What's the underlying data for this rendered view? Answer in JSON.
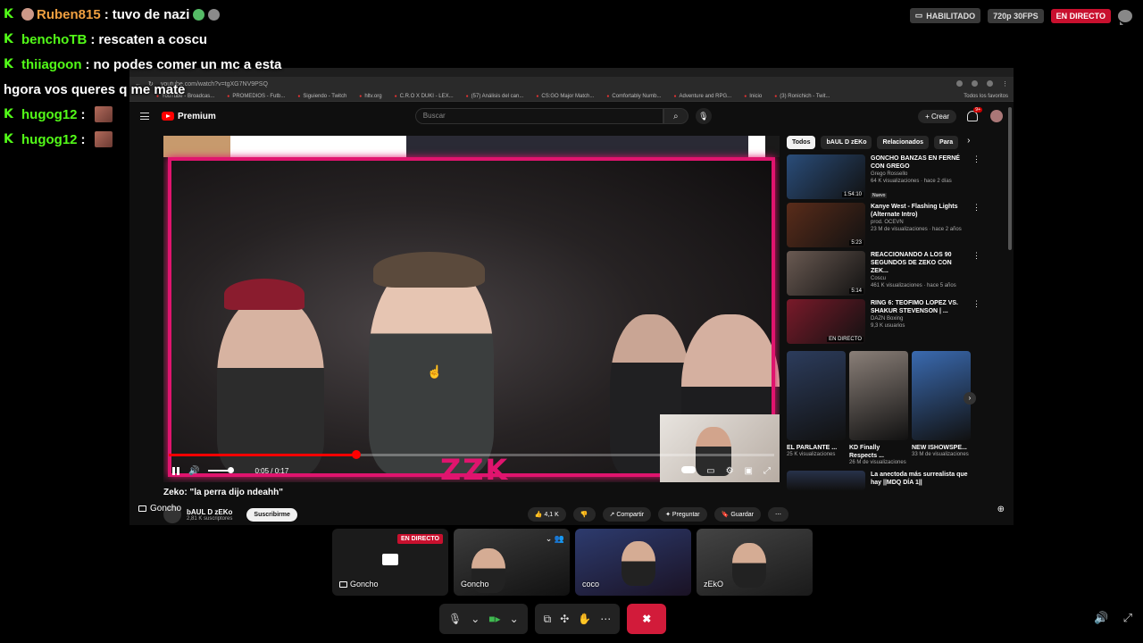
{
  "status": {
    "habilitado": "HABILITADO",
    "quality": "720p 30FPS",
    "live": "EN DIRECTO"
  },
  "chat": [
    {
      "user": "Ruben815",
      "message": "tuvo de nazi"
    },
    {
      "user": "benchoTB",
      "message": "rescaten a coscu"
    },
    {
      "user": "thiiagoon",
      "message": "no podes comer un mc a esta"
    },
    {
      "user": "",
      "message": "hgora vos queres q me mate"
    },
    {
      "user": "hugog12",
      "message": ""
    },
    {
      "user": "hugog12",
      "message": ""
    }
  ],
  "browser": {
    "url": "youtube.com/watch?v=tgXG7NV9PSQ",
    "bookmarks": [
      "YouTube - Broadcas...",
      "PROMEDIOS - Futb...",
      "Siguiendo - Twitch",
      "hltv.org",
      "C.R.O X DUKI - LEX...",
      "(57) Análisis del can...",
      "CS:GO Major Match...",
      "Comfortably Numb...",
      "Adventure and RPG...",
      "Inicio",
      "(3) Ronichich - Twit..."
    ],
    "bookmarks_right": "Todos los favoritos"
  },
  "youtube": {
    "logo": "Premium",
    "search_placeholder": "Buscar",
    "create": "Crear",
    "notifications": "9+",
    "video_title": "Zeko: \"la perra dijo ndeahh\"",
    "channel": "bAUL D zEKo",
    "subscribers": "2,81 K suscriptores",
    "subscribe": "Suscribirme",
    "likes": "4,1 K",
    "share": "Compartir",
    "ask": "Preguntar",
    "save": "Guardar",
    "time": "0:05 / 0:17",
    "progress": 0.31,
    "overlay_logo": "ZZK",
    "presenter": "Goncho",
    "chips": [
      "Todos",
      "bAUL D zEKo",
      "Relacionados",
      "Para"
    ],
    "recs": [
      {
        "title": "GONCHO BANZAS EN FERNÉ CON GREGO",
        "channel": "Grego Rossello",
        "meta": "64 K visualizaciones · hace 2 días",
        "tag": "Nuevo",
        "duration": "1:54:10",
        "color": "#2a4d7a"
      },
      {
        "title": "Kanye West - Flashing Lights (Alternate Intro)",
        "channel": "prod. OCEVN",
        "meta": "23 M de visualizaciones · hace 2 años",
        "tag": "",
        "duration": "5:23",
        "color": "#5a2c1a"
      },
      {
        "title": "REACCIONANDO A LOS 90 SEGUNDOS DE ZEKO CON ZEK...",
        "channel": "Coscu",
        "meta": "461 K visualizaciones · hace 5 años",
        "tag": "",
        "duration": "5:14",
        "color": "#6a5a52"
      },
      {
        "title": "RING 6: TEOFIMO LOPEZ VS. SHAKUR STEVENSON | ...",
        "channel": "DAZN Boxing",
        "meta": "9,3 K usuarios",
        "tag": "",
        "duration": "EN DIRECTO",
        "color": "#7a1a2a"
      }
    ],
    "shorts": [
      {
        "title": "EL PARLANTE ...",
        "views": "25 K visualizaciones",
        "color": "#2c3c5c"
      },
      {
        "title": "KD Finally Respects ...",
        "views": "26 M de visualizaciones",
        "color": "#8a7f78"
      },
      {
        "title": "NEW ISHOWSPE...",
        "views": "33 M de visualizaciones",
        "color": "#3a6ab0"
      }
    ],
    "last_rec": "La anectoda más surrealista que hay ||MDQ DÍA 1||"
  },
  "participants": [
    {
      "name": "Goncho",
      "live": "EN DIRECTO"
    },
    {
      "name": "Goncho"
    },
    {
      "name": "coco"
    },
    {
      "name": "zEkO"
    }
  ]
}
